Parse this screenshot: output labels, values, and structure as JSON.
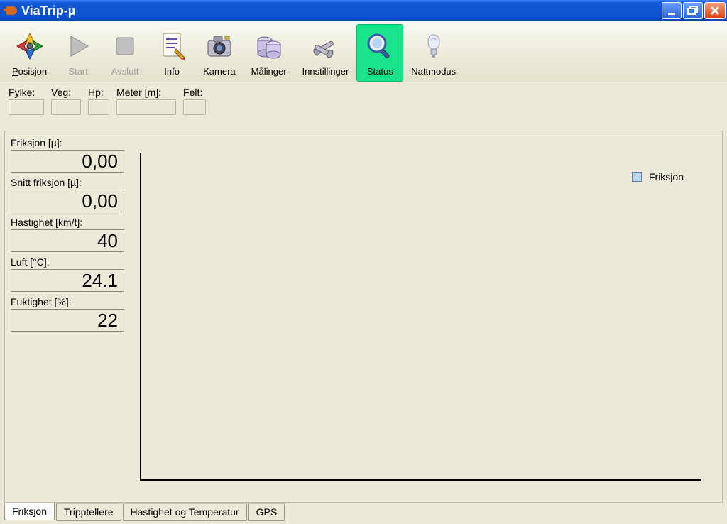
{
  "window": {
    "title": "ViaTrip-µ"
  },
  "toolbar": {
    "posisjon": "Posisjon",
    "start": "Start",
    "avslutt": "Avslutt",
    "info": "Info",
    "kamera": "Kamera",
    "malinger": "Målinger",
    "innstillinger": "Innstillinger",
    "status": "Status",
    "nattmodus": "Nattmodus"
  },
  "fields": {
    "fylke_label": "ylke:",
    "veg_label": "eg:",
    "hp_label": "p:",
    "meter_label": "eter [m]:",
    "felt_label": "elt:",
    "fylke": "",
    "veg": "",
    "hp": "",
    "meter": "",
    "felt": ""
  },
  "measurements": {
    "friksjon_label": "Friksjon [µ]:",
    "friksjon_value": "0,00",
    "snitt_label": "Snitt friksjon [µ]:",
    "snitt_value": "0,00",
    "hastighet_label": "Hastighet [km/t]:",
    "hastighet_value": "40",
    "luft_label": "Luft [°C]:",
    "luft_value": "24.1",
    "fuktighet_label": "Fuktighet [%]:",
    "fuktighet_value": "22"
  },
  "legend": {
    "friksjon": "Friksjon"
  },
  "tabs": {
    "friksjon": "Friksjon",
    "tripptellere": "Tripptellere",
    "hastighet_temp": "Hastighet og Temperatur",
    "gps": "GPS"
  },
  "chart_data": {
    "type": "line",
    "title": "",
    "xlabel": "",
    "ylabel": "",
    "series": [
      {
        "name": "Friksjon",
        "x": [],
        "y": []
      }
    ]
  }
}
